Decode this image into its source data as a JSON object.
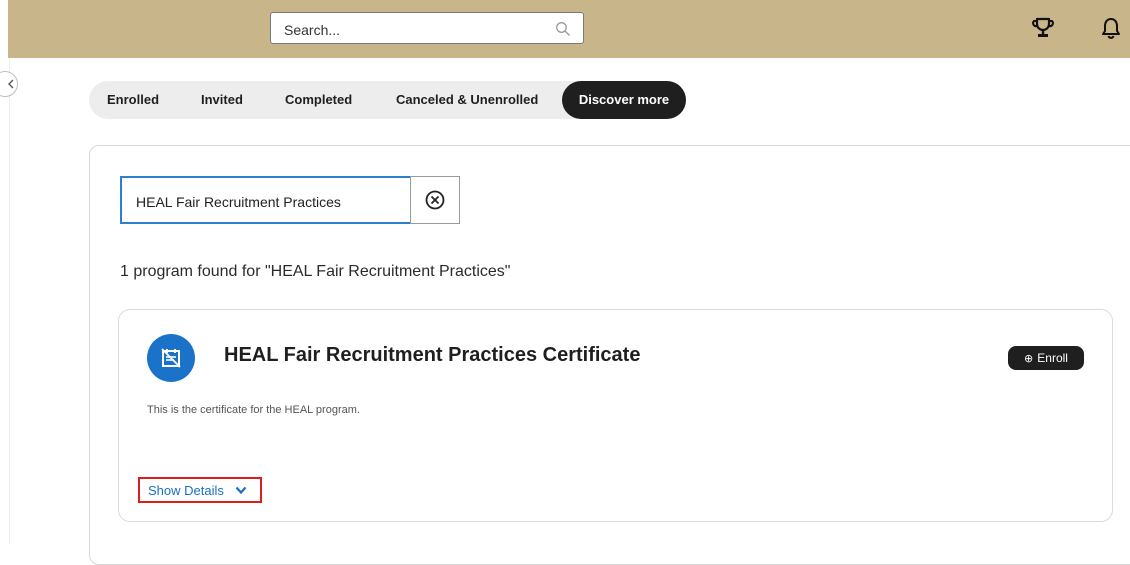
{
  "header": {
    "search_placeholder": "Search...",
    "icons": [
      "search-icon",
      "trophy-icon",
      "bell-icon"
    ],
    "background_color": "#c9b58a"
  },
  "tabs": [
    {
      "label": "Enrolled",
      "active": false
    },
    {
      "label": "Invited",
      "active": false
    },
    {
      "label": "Completed",
      "active": false
    },
    {
      "label": "Canceled & Unenrolled",
      "active": false
    },
    {
      "label": "Discover more",
      "active": true
    }
  ],
  "filter": {
    "value": "HEAL Fair Recruitment Practices",
    "clear_icon": "circle-x-icon"
  },
  "results": {
    "summary": "1 program found for \"HEAL Fair Recruitment Practices\""
  },
  "program": {
    "title": "HEAL Fair Recruitment Practices Certificate",
    "description": "This is the certificate for the HEAL program.",
    "enroll_label": "Enroll",
    "show_details_label": "Show Details",
    "icon": "certificate-icon",
    "icon_color": "#1a73c8"
  },
  "colors": {
    "accent": "#1a73c8",
    "active_tab": "#1f1f1f",
    "highlight_border": "#d91e1e"
  }
}
